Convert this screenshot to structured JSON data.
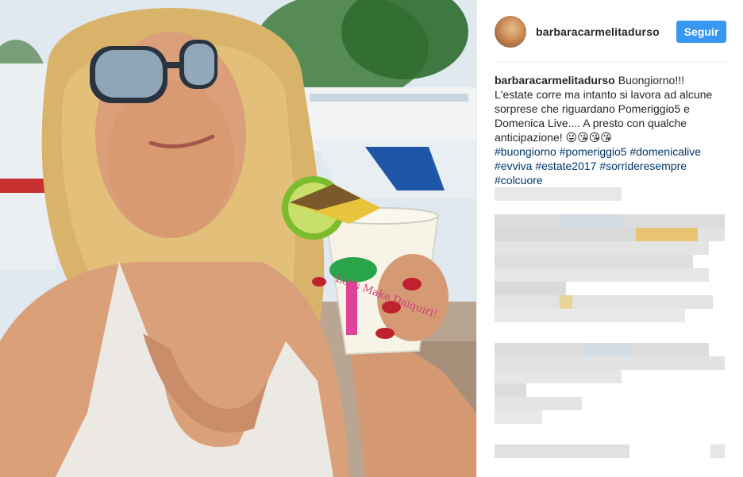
{
  "post": {
    "username": "barbaracarmelitadurso",
    "follow_label": "Seguir",
    "caption_author": "barbaracarmelitadurso",
    "caption_text": "Buongiorno!!! L'estate corre ma intanto si lavora ad alcune sorprese che riguardano Pomeriggio5 e Domenica Live.... A presto con qualche anticipazione! 😜😘😘😘",
    "hashtags": [
      "#buongiorno",
      "#pomeriggio5",
      "#domenicalive",
      "#evviva",
      "#estate2017",
      "#sorrideresempre",
      "#colcuore"
    ],
    "cup_text": "Let's Make Daiquiri!"
  },
  "colors": {
    "follow_button": "#3897f0",
    "hashtag": "#003569",
    "text": "#262626",
    "divider": "#efefef"
  },
  "comments_obscured": true
}
